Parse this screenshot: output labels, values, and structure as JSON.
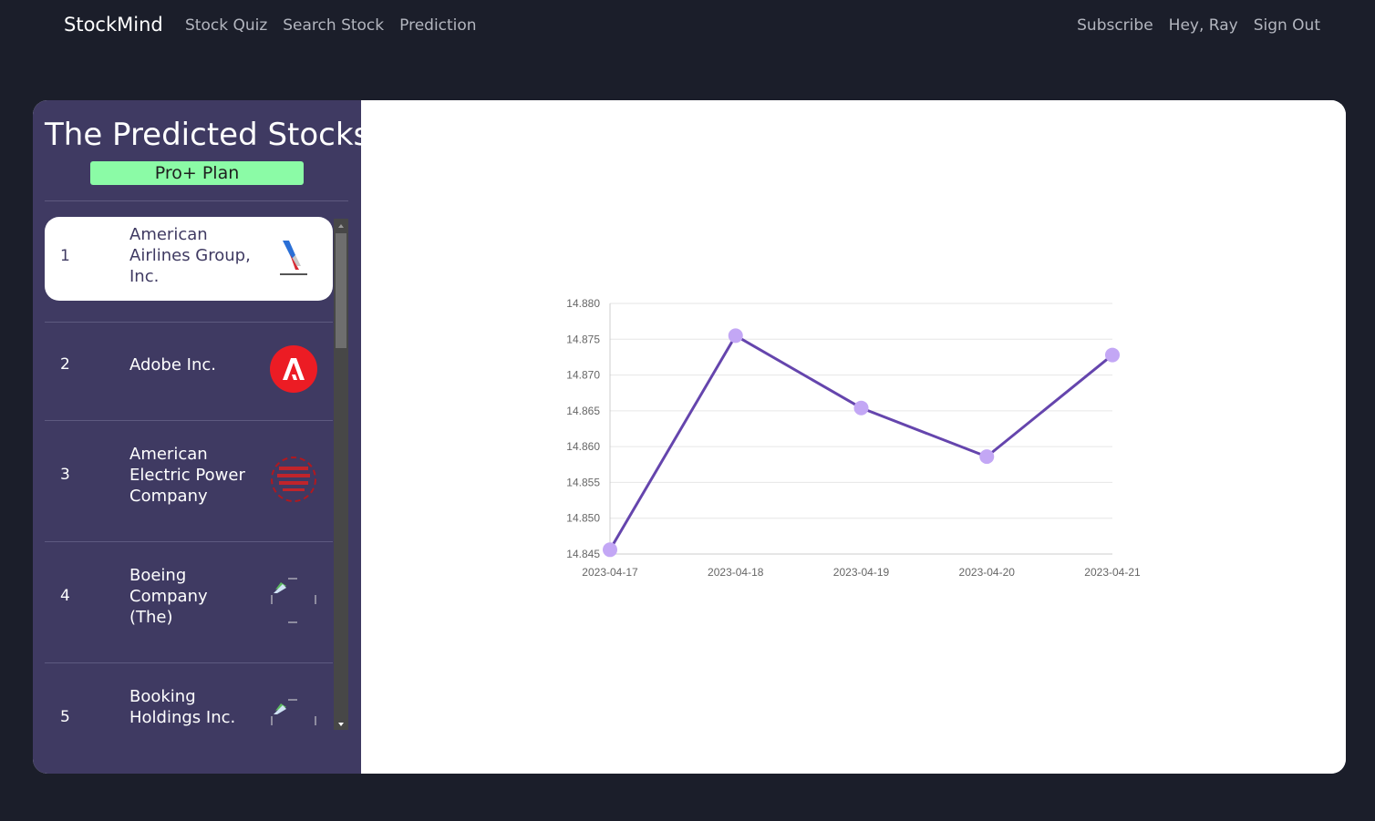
{
  "nav": {
    "brand": "StockMind",
    "left_links": [
      "Stock Quiz",
      "Search Stock",
      "Prediction"
    ],
    "right_links": [
      "Subscribe",
      "Hey, Ray",
      "Sign Out"
    ]
  },
  "sidebar": {
    "title": "The Predicted Stocks",
    "plan": "Pro+ Plan",
    "items": [
      {
        "rank": "1",
        "name": "American Airlines Group, Inc.",
        "logo": "american-airlines-logo",
        "active": true
      },
      {
        "rank": "2",
        "name": "Adobe Inc.",
        "logo": "adobe-logo",
        "active": false
      },
      {
        "rank": "3",
        "name": "American Electric Power Company",
        "logo": "aep-logo",
        "active": false
      },
      {
        "rank": "4",
        "name": "Boeing Company (The)",
        "logo": "broken-image-icon",
        "active": false
      },
      {
        "rank": "5",
        "name": "Booking Holdings Inc.",
        "logo": "broken-image-icon",
        "active": false
      }
    ]
  },
  "colors": {
    "page_bg": "#1b1e2a",
    "sidebar_bg": "#3f3a62",
    "plan_badge": "#8bfba6",
    "line": "#6545ad",
    "point": "#c3a7f5"
  },
  "chart_data": {
    "type": "line",
    "x": [
      "2023-04-17",
      "2023-04-18",
      "2023-04-19",
      "2023-04-20",
      "2023-04-21"
    ],
    "y": [
      14.8456,
      14.8755,
      14.8654,
      14.8586,
      14.8728
    ],
    "yticks": [
      "14.845",
      "14.850",
      "14.855",
      "14.860",
      "14.865",
      "14.870",
      "14.875",
      "14.880"
    ],
    "ylim": [
      14.845,
      14.88
    ],
    "grid": true,
    "legend": "none"
  }
}
